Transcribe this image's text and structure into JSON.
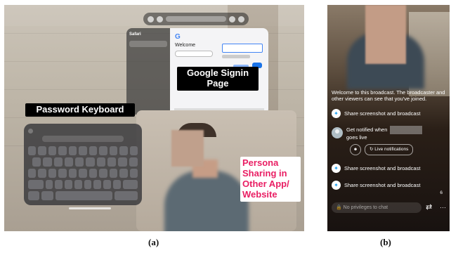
{
  "figure": {
    "caption_a": "(a)",
    "caption_b": "(b)"
  },
  "panel_a": {
    "label_google": "Google Signin Page",
    "label_keyboard": "Password Keyboard",
    "label_persona": "Persona Sharing in Other App/ Website",
    "safari_title": "Safari",
    "google_welcome": "Welcome",
    "label_color_persona": "#e91e63"
  },
  "panel_b": {
    "welcome_text": "Welcome to this broadcast. The broadcaster and other viewers can see that you've joined.",
    "share_text_1": "Share screenshot and broadcast",
    "notify_text": "Get notified when",
    "notify_text_2": "goes live",
    "live_button": "Live notifications",
    "share_text_2": "Share screenshot and broadcast",
    "share_text_3": "Share screenshot and broadcast",
    "viewer_count": "6",
    "chat_placeholder": "No privileges to chat"
  }
}
